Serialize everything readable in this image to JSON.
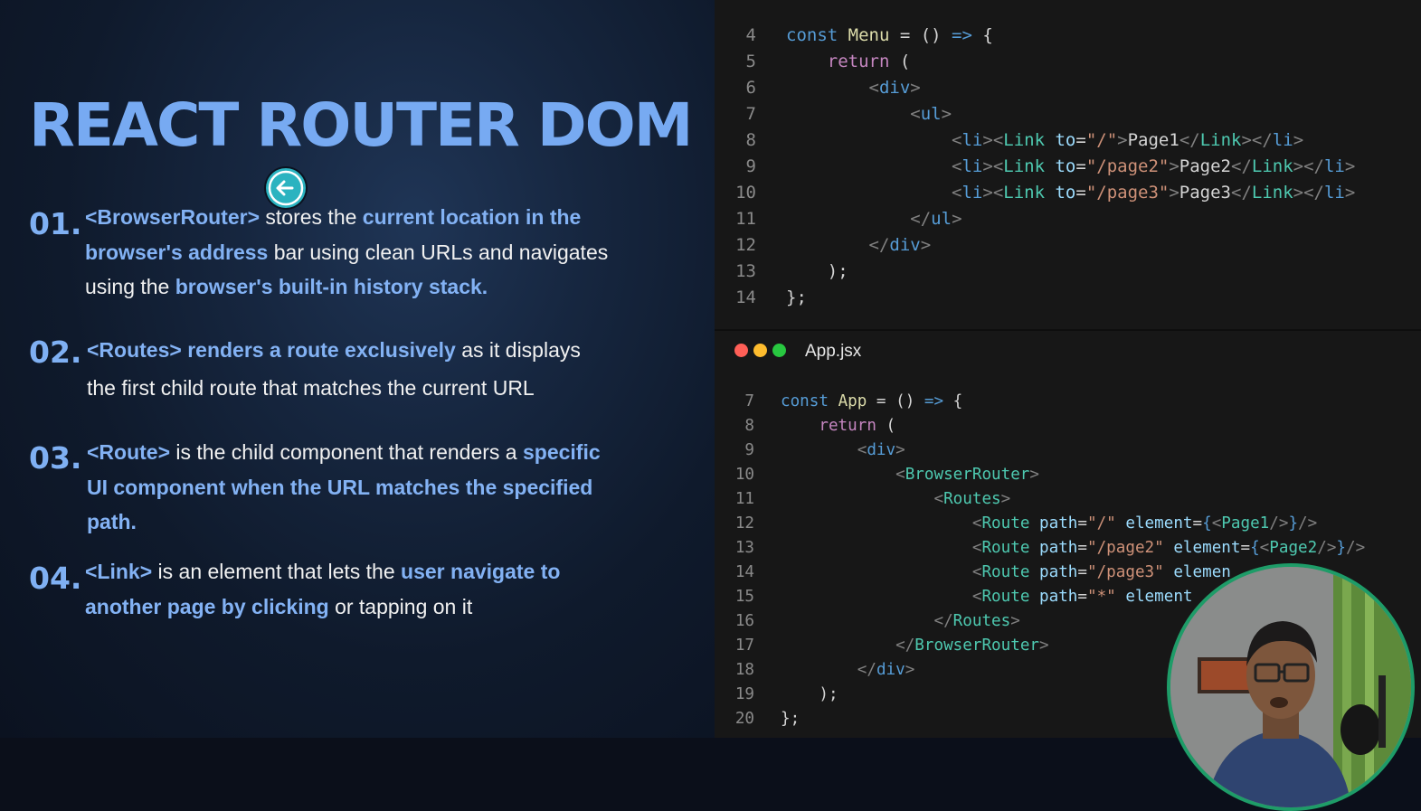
{
  "slide": {
    "title": "REACT ROUTER DOM",
    "items": [
      {
        "number": "01.",
        "parts": [
          {
            "text": "<BrowserRouter>",
            "hl": true
          },
          {
            "text": " stores the ",
            "hl": false
          },
          {
            "text": "current location in the browser's address",
            "hl": true
          },
          {
            "text": " bar using clean URLs and navigates using the ",
            "hl": false
          },
          {
            "text": "browser's built-in history stack.",
            "hl": true
          }
        ]
      },
      {
        "number": "02.",
        "parts": [
          {
            "text": "<Routes>  renders a route exclusively",
            "hl": true
          },
          {
            "text": " as it displays the first child route that matches the current URL",
            "hl": false
          }
        ]
      },
      {
        "number": "03.",
        "parts": [
          {
            "text": "<Route>",
            "hl": true
          },
          {
            "text": " is the child component that renders a ",
            "hl": false
          },
          {
            "text": "specific UI component when the URL matches the specified path.",
            "hl": true
          }
        ]
      },
      {
        "number": "04.",
        "parts": [
          {
            "text": "<Link>",
            "hl": true
          },
          {
            "text": " is an element that lets the ",
            "hl": false
          },
          {
            "text": "user navigate to another page by clicking",
            "hl": true
          },
          {
            "text": " or tapping on it",
            "hl": false
          }
        ]
      }
    ]
  },
  "editor_top": {
    "lines": [
      {
        "n": "4",
        "tokens": [
          [
            "k",
            "const "
          ],
          [
            "f",
            "Menu"
          ],
          [
            "p",
            " = () "
          ],
          [
            "k",
            "=>"
          ],
          [
            "p",
            " {"
          ]
        ]
      },
      {
        "n": "5",
        "tokens": [
          [
            "p",
            "    "
          ],
          [
            "c",
            "return"
          ],
          [
            "p",
            " ("
          ]
        ]
      },
      {
        "n": "6",
        "tokens": [
          [
            "p",
            "        "
          ],
          [
            "g",
            "<"
          ],
          [
            "k",
            "div"
          ],
          [
            "g",
            ">"
          ]
        ]
      },
      {
        "n": "7",
        "tokens": [
          [
            "p",
            "            "
          ],
          [
            "g",
            "<"
          ],
          [
            "k",
            "ul"
          ],
          [
            "g",
            ">"
          ]
        ]
      },
      {
        "n": "8",
        "tokens": [
          [
            "p",
            "                "
          ],
          [
            "g",
            "<"
          ],
          [
            "k",
            "li"
          ],
          [
            "g",
            "><"
          ],
          [
            "t",
            "Link"
          ],
          [
            "p",
            " "
          ],
          [
            "a",
            "to"
          ],
          [
            "p",
            "="
          ],
          [
            "s",
            "\"/\""
          ],
          [
            "g",
            ">"
          ],
          [
            "p",
            "Page1"
          ],
          [
            "g",
            "</"
          ],
          [
            "t",
            "Link"
          ],
          [
            "g",
            "></"
          ],
          [
            "k",
            "li"
          ],
          [
            "g",
            ">"
          ]
        ]
      },
      {
        "n": "9",
        "tokens": [
          [
            "p",
            "                "
          ],
          [
            "g",
            "<"
          ],
          [
            "k",
            "li"
          ],
          [
            "g",
            "><"
          ],
          [
            "t",
            "Link"
          ],
          [
            "p",
            " "
          ],
          [
            "a",
            "to"
          ],
          [
            "p",
            "="
          ],
          [
            "s",
            "\"/page2\""
          ],
          [
            "g",
            ">"
          ],
          [
            "p",
            "Page2"
          ],
          [
            "g",
            "</"
          ],
          [
            "t",
            "Link"
          ],
          [
            "g",
            "></"
          ],
          [
            "k",
            "li"
          ],
          [
            "g",
            ">"
          ]
        ]
      },
      {
        "n": "10",
        "tokens": [
          [
            "p",
            "                "
          ],
          [
            "g",
            "<"
          ],
          [
            "k",
            "li"
          ],
          [
            "g",
            "><"
          ],
          [
            "t",
            "Link"
          ],
          [
            "p",
            " "
          ],
          [
            "a",
            "to"
          ],
          [
            "p",
            "="
          ],
          [
            "s",
            "\"/page3\""
          ],
          [
            "g",
            ">"
          ],
          [
            "p",
            "Page3"
          ],
          [
            "g",
            "</"
          ],
          [
            "t",
            "Link"
          ],
          [
            "g",
            "></"
          ],
          [
            "k",
            "li"
          ],
          [
            "g",
            ">"
          ]
        ]
      },
      {
        "n": "11",
        "tokens": [
          [
            "p",
            "            "
          ],
          [
            "g",
            "</"
          ],
          [
            "k",
            "ul"
          ],
          [
            "g",
            ">"
          ]
        ]
      },
      {
        "n": "12",
        "tokens": [
          [
            "p",
            "        "
          ],
          [
            "g",
            "</"
          ],
          [
            "k",
            "div"
          ],
          [
            "g",
            ">"
          ]
        ]
      },
      {
        "n": "13",
        "tokens": [
          [
            "p",
            "    );"
          ]
        ]
      },
      {
        "n": "14",
        "tokens": [
          [
            "p",
            "};"
          ]
        ]
      }
    ]
  },
  "editor_bottom": {
    "filename": "App.jsx",
    "dot_colors": [
      "#ff5f57",
      "#febc2e",
      "#28c840"
    ],
    "lines": [
      {
        "n": "7",
        "tokens": [
          [
            "k",
            "const "
          ],
          [
            "f",
            "App"
          ],
          [
            "p",
            " = () "
          ],
          [
            "k",
            "=>"
          ],
          [
            "p",
            " {"
          ]
        ]
      },
      {
        "n": "8",
        "tokens": [
          [
            "p",
            "    "
          ],
          [
            "c",
            "return"
          ],
          [
            "p",
            " ("
          ]
        ]
      },
      {
        "n": "9",
        "tokens": [
          [
            "p",
            "        "
          ],
          [
            "g",
            "<"
          ],
          [
            "k",
            "div"
          ],
          [
            "g",
            ">"
          ]
        ]
      },
      {
        "n": "10",
        "tokens": [
          [
            "p",
            "            "
          ],
          [
            "g",
            "<"
          ],
          [
            "t",
            "BrowserRouter"
          ],
          [
            "g",
            ">"
          ]
        ]
      },
      {
        "n": "11",
        "tokens": [
          [
            "p",
            "                "
          ],
          [
            "g",
            "<"
          ],
          [
            "t",
            "Routes"
          ],
          [
            "g",
            ">"
          ]
        ]
      },
      {
        "n": "12",
        "tokens": [
          [
            "p",
            "                    "
          ],
          [
            "g",
            "<"
          ],
          [
            "t",
            "Route"
          ],
          [
            "p",
            " "
          ],
          [
            "a",
            "path"
          ],
          [
            "p",
            "="
          ],
          [
            "s",
            "\"/\""
          ],
          [
            "p",
            " "
          ],
          [
            "a",
            "element"
          ],
          [
            "p",
            "="
          ],
          [
            "k",
            "{"
          ],
          [
            "g",
            "<"
          ],
          [
            "t",
            "Page1"
          ],
          [
            "g",
            "/>"
          ],
          [
            "k",
            "}"
          ],
          [
            "g",
            "/>"
          ]
        ]
      },
      {
        "n": "13",
        "tokens": [
          [
            "p",
            "                    "
          ],
          [
            "g",
            "<"
          ],
          [
            "t",
            "Route"
          ],
          [
            "p",
            " "
          ],
          [
            "a",
            "path"
          ],
          [
            "p",
            "="
          ],
          [
            "s",
            "\"/page2\""
          ],
          [
            "p",
            " "
          ],
          [
            "a",
            "element"
          ],
          [
            "p",
            "="
          ],
          [
            "k",
            "{"
          ],
          [
            "g",
            "<"
          ],
          [
            "t",
            "Page2"
          ],
          [
            "g",
            "/>"
          ],
          [
            "k",
            "}"
          ],
          [
            "g",
            "/>"
          ]
        ]
      },
      {
        "n": "14",
        "tokens": [
          [
            "p",
            "                    "
          ],
          [
            "g",
            "<"
          ],
          [
            "t",
            "Route"
          ],
          [
            "p",
            " "
          ],
          [
            "a",
            "path"
          ],
          [
            "p",
            "="
          ],
          [
            "s",
            "\"/page3\""
          ],
          [
            "p",
            " "
          ],
          [
            "a",
            "elemen"
          ]
        ]
      },
      {
        "n": "15",
        "tokens": [
          [
            "p",
            "                    "
          ],
          [
            "g",
            "<"
          ],
          [
            "t",
            "Route"
          ],
          [
            "p",
            " "
          ],
          [
            "a",
            "path"
          ],
          [
            "p",
            "="
          ],
          [
            "s",
            "\"*\""
          ],
          [
            "p",
            " "
          ],
          [
            "a",
            "element"
          ]
        ]
      },
      {
        "n": "16",
        "tokens": [
          [
            "p",
            "                "
          ],
          [
            "g",
            "</"
          ],
          [
            "t",
            "Routes"
          ],
          [
            "g",
            ">"
          ]
        ]
      },
      {
        "n": "17",
        "tokens": [
          [
            "p",
            "            "
          ],
          [
            "g",
            "</"
          ],
          [
            "t",
            "BrowserRouter"
          ],
          [
            "g",
            ">"
          ]
        ]
      },
      {
        "n": "18",
        "tokens": [
          [
            "p",
            "        "
          ],
          [
            "g",
            "</"
          ],
          [
            "k",
            "div"
          ],
          [
            "g",
            ">"
          ]
        ]
      },
      {
        "n": "19",
        "tokens": [
          [
            "p",
            "    );"
          ]
        ]
      },
      {
        "n": "20",
        "tokens": [
          [
            "p",
            "};"
          ]
        ]
      }
    ]
  },
  "colors": {
    "title_blue": "#77aaf2",
    "highlight_blue": "#83b2f4",
    "nav_button": "#2bb3c0",
    "webcam_ring": "#1e9c68"
  },
  "icons": {
    "nav_button": "arrow-left-icon",
    "webcam": "presenter-avatar"
  }
}
